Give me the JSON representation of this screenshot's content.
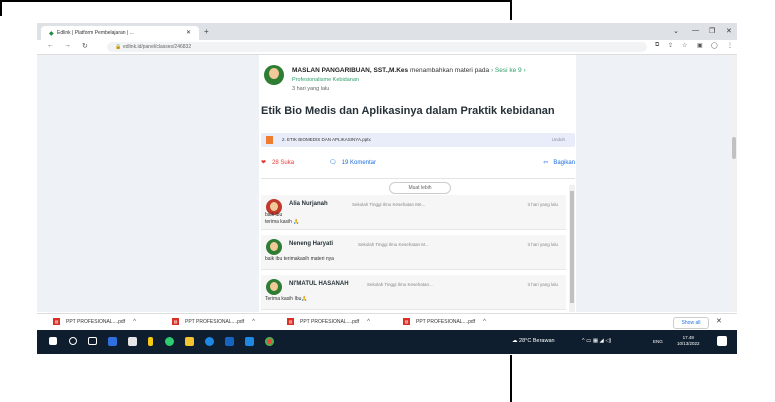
{
  "browser": {
    "tab_title": "Edlink | Platform Pembelajaran | ...",
    "url": "edlink.id/panel/classes/246832"
  },
  "post": {
    "author": "MASLAN PANGARIBUAN, SST.,M.Kes",
    "action": "menambahkan materi pada",
    "session": "Sesi ke 9",
    "subject": "Profesionalisme Kebidanan",
    "time": "3 hari yang lalu",
    "title": "Etik Bio Medis dan Aplikasinya dalam Praktik kebidanan",
    "attachment": {
      "name": "2. ETIK BIOMEDIS DAN APLIKASINYA.pptx",
      "download_label": "Unduh"
    },
    "likes_count": "28",
    "likes_label": "Suka",
    "comments_count": "19",
    "comments_label": "Komentar",
    "share_label": "Bagikan"
  },
  "comments_section": {
    "more_label": "Muat lebih",
    "items": [
      {
        "name": "Alia Nurjanah",
        "school": "Sekolah Tinggi Ilmu Kesehatan Me...",
        "time": "3 hari yang lalu",
        "text": "baik ibu\nterima kasih 🙏"
      },
      {
        "name": "Neneng Haryati",
        "school": "Sekolah Tinggi Ilmu Kesehatan M...",
        "time": "3 hari yang lalu",
        "text": "baik ibu terimakasih materi nya"
      },
      {
        "name": "NI'MATUL HASANAH",
        "school": "Sekolah Tinggi Ilmu Kesehatan...",
        "time": "3 hari yang lalu",
        "text": "Terima kasih Ibu🙏"
      }
    ]
  },
  "downloads": {
    "items": [
      {
        "label": "PPT PROFESIONAL....pdf"
      },
      {
        "label": "PPT PROFESIONAL....pdf"
      },
      {
        "label": "PPT PROFESIONAL....pdf"
      },
      {
        "label": "PPT PROFESIONAL....pdf"
      }
    ],
    "show_all": "Show all"
  },
  "taskbar": {
    "weather": "28°C Berawan",
    "lang": "ENG",
    "time": "17.48",
    "date": "10/13/2022"
  }
}
